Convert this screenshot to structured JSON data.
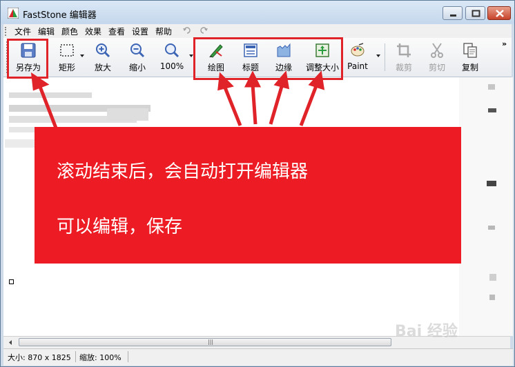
{
  "window": {
    "title": "FastStone 编辑器"
  },
  "menu": [
    {
      "id": "file",
      "label": "文件"
    },
    {
      "id": "edit",
      "label": "编辑"
    },
    {
      "id": "color",
      "label": "颜色"
    },
    {
      "id": "effects",
      "label": "效果"
    },
    {
      "id": "view",
      "label": "查看"
    },
    {
      "id": "settings",
      "label": "设置"
    },
    {
      "id": "help",
      "label": "帮助"
    }
  ],
  "toolbar": {
    "save_as": "另存为",
    "rectangle": "矩形",
    "zoom_in": "放大",
    "zoom_out": "缩小",
    "zoom_level": "100%",
    "draw": "绘图",
    "caption": "标题",
    "edge": "边缘",
    "resize": "调整大小",
    "paint": "Paint",
    "crop": "裁剪",
    "cut": "剪切",
    "copy": "复制"
  },
  "status": {
    "size": "大小: 870 x 1825",
    "zoom": "缩放: 100%"
  },
  "callout": {
    "line1": "滚动结束后，会自动打开编辑器",
    "line2": "可以编辑，保存"
  },
  "watermark": "Bai 经验",
  "colors": {
    "highlight_red": "#e02229",
    "callout_red": "#ed1c24"
  }
}
